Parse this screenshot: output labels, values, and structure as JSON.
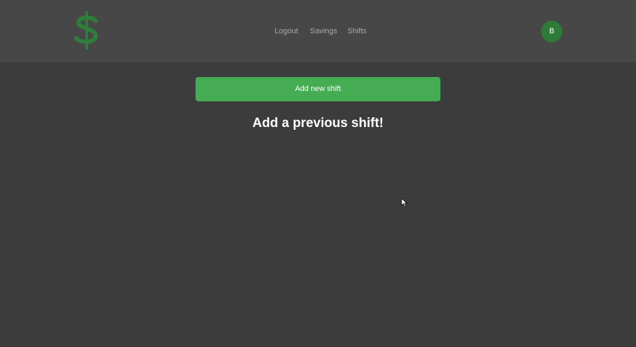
{
  "header": {
    "logo_icon": "dollar-sign-icon",
    "brand_color": "#2f7d3a",
    "nav": {
      "logout": "Logout",
      "savings": "Savings",
      "shifts": "Shifts"
    },
    "avatar_initial": "B"
  },
  "main": {
    "add_button_label": "Add new shift",
    "empty_heading": "Add a previous shift!"
  },
  "colors": {
    "header_bg": "#474747",
    "page_bg": "#3c3c3c",
    "button_green": "#45ac53",
    "avatar_green": "#2e7a37"
  }
}
